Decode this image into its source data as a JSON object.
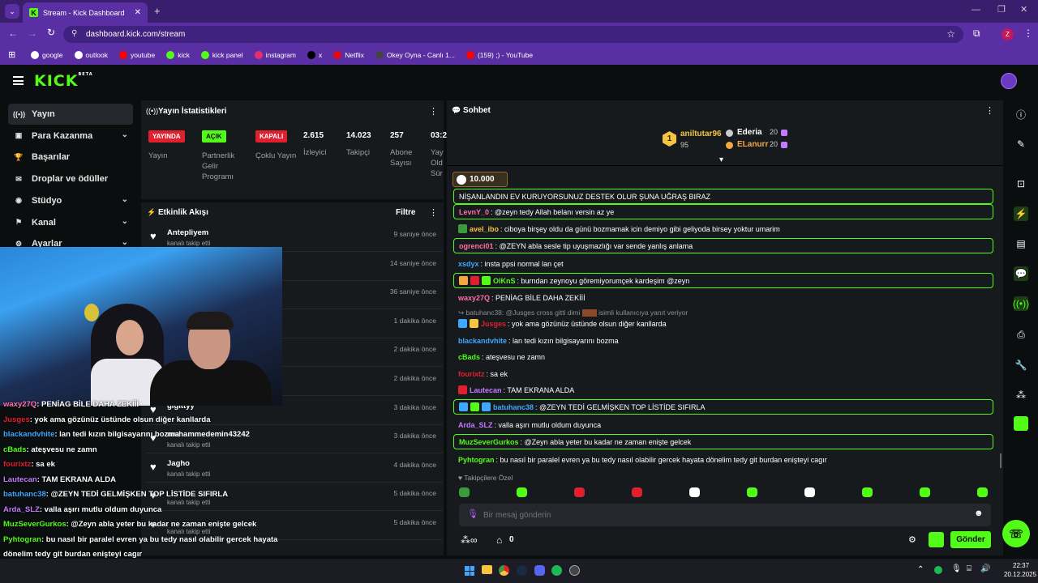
{
  "browser": {
    "tab_title": "Stream - Kick Dashboard",
    "url": "dashboard.kick.com/stream",
    "profile_initial": "Z",
    "bookmarks": [
      {
        "label": "google",
        "color": "#ffffff"
      },
      {
        "label": "outlook",
        "color": "#ffffff"
      },
      {
        "label": "youtube",
        "color": "#ff0000"
      },
      {
        "label": "kick",
        "color": "#53fc18"
      },
      {
        "label": "kick panel",
        "color": "#53fc18"
      },
      {
        "label": "instagram",
        "color": "#e1306c"
      },
      {
        "label": "x",
        "color": "#000000"
      },
      {
        "label": "Netflix",
        "color": "#e50914"
      },
      {
        "label": "Okey Oyna - Canlı 1...",
        "color": "#444444"
      },
      {
        "label": "(159) ;) - YouTube",
        "color": "#ff0000"
      }
    ]
  },
  "kick": {
    "logo": "KICK",
    "logo_beta": "BETA"
  },
  "sidebar": {
    "items": [
      {
        "icon": "broadcast-icon",
        "glyph": "((•))",
        "label": "Yayın",
        "active": true,
        "chevron": false
      },
      {
        "icon": "wallet-icon",
        "glyph": "▣",
        "label": "Para Kazanma",
        "active": false,
        "chevron": true
      },
      {
        "icon": "trophy-icon",
        "glyph": "🏆",
        "label": "Başarılar",
        "active": false,
        "chevron": false
      },
      {
        "icon": "gift-icon",
        "glyph": "✉",
        "label": "Droplar ve ödüller",
        "active": false,
        "chevron": false
      },
      {
        "icon": "camera-icon",
        "glyph": "◉",
        "label": "Stüdyo",
        "active": false,
        "chevron": true
      },
      {
        "icon": "channel-icon",
        "glyph": "⚑",
        "label": "Kanal",
        "active": false,
        "chevron": true
      },
      {
        "icon": "settings-icon",
        "glyph": "⚙",
        "label": "Ayarlar",
        "active": false,
        "chevron": true
      }
    ]
  },
  "stats": {
    "title": "Yayın İstatistikleri",
    "badges": [
      {
        "badge": "YAYINDA",
        "label": "Yayın",
        "bg": "#e0202f",
        "fg": "#ffffff"
      },
      {
        "badge": "AÇIK",
        "label": "Partnerlik Gelir Programı",
        "bg": "#53fc18",
        "fg": "#0b0e0f"
      },
      {
        "badge": "KAPALI",
        "label": "Çoklu Yayın",
        "bg": "#e0202f",
        "fg": "#ffffff"
      }
    ],
    "numbers": [
      {
        "value": "2.615",
        "label": "İzleyici"
      },
      {
        "value": "14.023",
        "label": "Takipçi"
      },
      {
        "value": "257",
        "label": "Abone Sayısı"
      },
      {
        "value": "03:2",
        "label": "Yay Old Sür"
      }
    ]
  },
  "activity": {
    "title": "Etkinlik Akışı",
    "filter": "Filtre",
    "rows": [
      {
        "name": "Antepliyem",
        "sub": "kanalı takip etti",
        "time": "9 saniye önce"
      },
      {
        "name": "",
        "sub": "",
        "time": "14 saniye önce"
      },
      {
        "name": "",
        "sub": "",
        "time": "36 saniye önce"
      },
      {
        "name": "",
        "sub": "",
        "time": "1 dakika önce"
      },
      {
        "name": "",
        "sub": "",
        "time": "2 dakika önce"
      },
      {
        "name": "",
        "sub": "",
        "time": "2 dakika önce"
      },
      {
        "name": "gigittyy",
        "sub": "",
        "time": "3 dakika önce"
      },
      {
        "name": "muhammedemin43242",
        "sub": "kanalı takip etti",
        "time": "3 dakika önce"
      },
      {
        "name": "Jagho",
        "sub": "kanalı takip etti",
        "time": "4 dakika önce"
      },
      {
        "name": "",
        "sub": "kanalı takip etti",
        "time": "5 dakika önce"
      },
      {
        "name": "",
        "sub": "kanalı takip etti",
        "time": "5 dakika önce"
      }
    ]
  },
  "chat": {
    "title": "Sohbet",
    "top_gifters": [
      {
        "rank": "1",
        "name": "aniltutar96",
        "amount": "95",
        "color": "#f5c542"
      },
      {
        "rank": "",
        "name": "Ederia",
        "amount": "20",
        "color": "#ffffff"
      },
      {
        "rank": "",
        "name": "ELanurr",
        "amount": "20",
        "color": "#f5a742"
      }
    ],
    "pinned_goal": "10.000",
    "messages": [
      {
        "user": "",
        "text": "NİŞANLANDIN EV KURUYORSUNUZ DESTEK OLUR ŞUNA UĞRAŞ BIRAZ",
        "color": "#ffffff",
        "hl": true,
        "icons": []
      },
      {
        "user": "LevnY_0",
        "text": ": @zeyn tedy Allah belanı versin az ye",
        "color": "#ff6fa8",
        "hl": true,
        "icons": []
      },
      {
        "user": "avel_ibo",
        "text": ": ciboya birşey oldu da günü bozmamak icin demiyo gibi geliyoda birsey yoktur umarim",
        "color": "#f5c542",
        "hl": false,
        "icons": [
          "#3b9b3b"
        ]
      },
      {
        "user": "ogrenci01",
        "text": ": @ZEYN abla sesle tip uyuşmazlığı var sende yanlış anlama",
        "color": "#ff6fa8",
        "hl": true,
        "icons": []
      },
      {
        "user": "xsdyx",
        "text": ": insta ppsi normal lan çet",
        "color": "#3fa7ff",
        "hl": false,
        "icons": []
      },
      {
        "user": "OlKnS",
        "text": ": burndan zeynoyu göremiyorumçek kardeşim @zeyn",
        "color": "#53fc18",
        "hl": true,
        "icons": [
          "#f5a742",
          "#e0202f",
          "#53fc18"
        ]
      },
      {
        "user": "waxy27Q",
        "text": ": PENİAG BİLE DAHA ZEKİİİ",
        "color": "#ff6fa8",
        "hl": false,
        "icons": []
      },
      {
        "user": "Jusges",
        "text": ": yok ama gözünüz üstünde olsun diğer kanllarda",
        "color": "#e0202f",
        "hl": false,
        "icons": [
          "#3fa7ff",
          "#f5c542"
        ]
      },
      {
        "user": "blackandvhite",
        "text": ": lan tedi kızın bilgisayarını bozma",
        "color": "#3fa7ff",
        "hl": false,
        "icons": []
      },
      {
        "user": "cBads",
        "text": ": ateşvesu ne zamn",
        "color": "#53fc18",
        "hl": false,
        "icons": []
      },
      {
        "user": "fourixtz",
        "text": ": sa ek",
        "color": "#e0202f",
        "hl": false,
        "icons": []
      },
      {
        "user": "Lautecan",
        "text": ": TAM EKRANA ALDA",
        "color": "#c27bff",
        "hl": false,
        "icons": [
          "#e0202f"
        ]
      },
      {
        "user": "batuhanc38",
        "text": ": @ZEYN TEDİ GELMİŞKEN TOP LİSTİDE SIFIRLA",
        "color": "#3fa7ff",
        "hl": true,
        "icons": [
          "#3fa7ff",
          "#53fc18",
          "#3fa7ff"
        ]
      },
      {
        "user": "Arda_SLZ",
        "text": ": valla aşırı mutlu oldum duyunca",
        "color": "#c27bff",
        "hl": false,
        "icons": []
      },
      {
        "user": "MuzSeverGurkos",
        "text": ": @Zeyn abla yeter bu kadar ne zaman enişte gelcek",
        "color": "#53fc18",
        "hl": true,
        "icons": []
      },
      {
        "user": "Pyhtogran",
        "text": ": bu nasıl bir paralel evren ya bu tedy nasıl olabilir gercek hayata dönelim tedy git burdan enişteyi cagır",
        "color": "#53fc18",
        "hl": false,
        "icons": []
      }
    ],
    "reply_to": "batuhanc38: @Jusges cross gitti dimi",
    "reply_suffix": "isimli kullanıcıya yanıt veriyor",
    "followers_only": "Takipçilere Özel",
    "input_placeholder": "Bir mesaj gönderin",
    "send_label": "Gönder",
    "points": "0"
  },
  "video_overlay": [
    {
      "user": "waxy27Q",
      "text": ": PENİAG BİLE DAHA ZEKİİİ",
      "color": "#ff6fa8"
    },
    {
      "user": "Jusges",
      "text": ": yok ama gözünüz üstünde olsun diğer kanllarda",
      "color": "#e0202f"
    },
    {
      "user": "blackandvhite",
      "text": ": lan tedi kızın bilgisayarını bozma",
      "color": "#3fa7ff"
    },
    {
      "user": "cBads",
      "text": ": ateşvesu ne zamn",
      "color": "#53fc18"
    },
    {
      "user": "fourixtz",
      "text": ": sa ek",
      "color": "#e0202f"
    },
    {
      "user": "Lautecan",
      "text": ": TAM EKRANA ALDA",
      "color": "#c27bff"
    },
    {
      "user": "batuhanc38",
      "text": ": @ZEYN TEDİ GELMİŞKEN TOP LİSTİDE SIFIRLA",
      "color": "#3fa7ff"
    },
    {
      "user": "Arda_SLZ",
      "text": ": valla aşırı mutlu oldum duyunca",
      "color": "#c27bff"
    },
    {
      "user": "MuzSeverGurkos",
      "text": ": @Zeyn abla yeter bu kadar ne zaman enişte gelcek",
      "color": "#53fc18"
    },
    {
      "user": "Pyhtogran",
      "text": ": bu nasıl bir paralel evren ya bu tedy nasıl olabilir gercek hayata",
      "color": "#53fc18"
    },
    {
      "user": "",
      "text": "dönelim tedy git burdan enişteyi cagır",
      "color": "#ffffff"
    }
  ],
  "taskbar": {
    "time": "22:37",
    "date": "20.12.2025"
  }
}
